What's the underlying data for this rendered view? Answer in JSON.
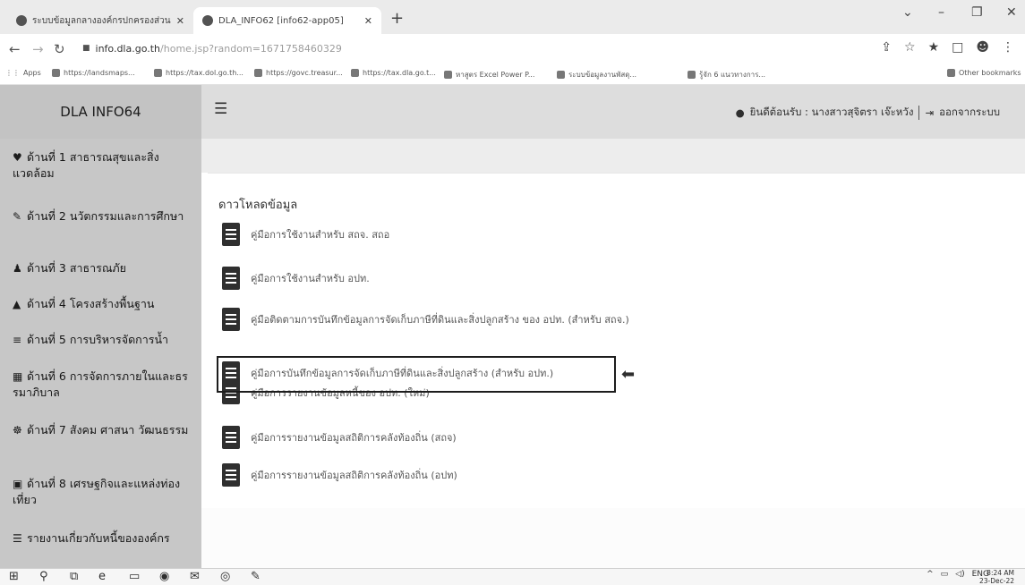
{
  "browser": {
    "tabs": [
      {
        "title": "ระบบข้อมูลกลางองค์กรปกครองส่วนท้องถิ่น"
      },
      {
        "title": "DLA_INFO62 [info62-app05]"
      }
    ],
    "url_host": "info.dla.go.th",
    "url_path": "/home.jsp?random=1671758460329",
    "bookmarks": [
      {
        "label": "Apps"
      },
      {
        "label": "https://landsmaps..."
      },
      {
        "label": "https://tax.dol.go.th..."
      },
      {
        "label": "https://govc.treasur..."
      },
      {
        "label": "https://tax.dla.go.t..."
      },
      {
        "label": "หาสูตร Excel Power P..."
      },
      {
        "label": "ระบบข้อมูลงานพัสดุ..."
      },
      {
        "label": "รู้จัก 6 แนวทางการ..."
      },
      {
        "label": "Other bookmarks"
      }
    ]
  },
  "app": {
    "brand": "DLA INFO64",
    "user": {
      "welcome": "ยินดีต้อนรับ : นางสาวสุจิตรา เจ๊ะหวัง",
      "logout": "ออกจากระบบ"
    },
    "sidebar": [
      {
        "icon": "heart-icon",
        "glyph": "♥",
        "label": "ด้านที่ 1 สาธารณสุขและสิ่งแวดล้อม"
      },
      {
        "icon": "education-icon",
        "glyph": "✎",
        "label": "ด้านที่ 2 นวัตกรรมและการศึกษา"
      },
      {
        "icon": "people-icon",
        "glyph": "♟",
        "label": "ด้านที่ 3 สาธารณภัย"
      },
      {
        "icon": "road-icon",
        "glyph": "▲",
        "label": "ด้านที่ 4 โครงสร้างพื้นฐาน"
      },
      {
        "icon": "water-icon",
        "glyph": "≡",
        "label": "ด้านที่ 5 การบริหารจัดการน้ำ"
      },
      {
        "icon": "building-icon",
        "glyph": "▦",
        "label": "ด้านที่ 6 การจัดการภายในและธรรมาภิบาล"
      },
      {
        "icon": "group-icon",
        "glyph": "☸",
        "label": "ด้านที่ 7 สังคม ศาสนา วัฒนธรรม"
      },
      {
        "icon": "money-icon",
        "glyph": "▣",
        "label": "ด้านที่ 8 เศรษฐกิจและแหล่งท่องเที่ยว"
      },
      {
        "icon": "report-icon",
        "glyph": "☰",
        "label": "รายงานเกี่ยวกับหนี้ขององค์กร"
      }
    ],
    "panel_title": "ดาวโหลดข้อมูล",
    "documents": [
      {
        "label": "คู่มือการใช้งานสำหรับ สถจ. สถอ"
      },
      {
        "label": "คู่มือการใช้งานสำหรับ อปท."
      },
      {
        "label": "คู่มือติดตามการบันทึกข้อมูลการจัดเก็บภาษีที่ดินและสิ่งปลูกสร้าง ของ อปท. (สำหรับ สถจ.)"
      },
      {
        "label": "คู่มือการบันทึกข้อมูลการจัดเก็บภาษีที่ดินและสิ่งปลูกสร้าง (สำหรับ อปท.)"
      },
      {
        "label": "คู่มือการรายงานข้อมูลหนี้ของ อปท. (ใหม่)"
      },
      {
        "label": "คู่มือการรายงานข้อมูลสถิติการคลังท้องถิ่น (สถจ)"
      },
      {
        "label": "คู่มือการรายงานข้อมูลสถิติการคลังท้องถิ่น (อปท)"
      }
    ]
  },
  "taskbar": {
    "lang": "ENG",
    "time": "8:24 AM",
    "date": "23-Dec-22"
  }
}
